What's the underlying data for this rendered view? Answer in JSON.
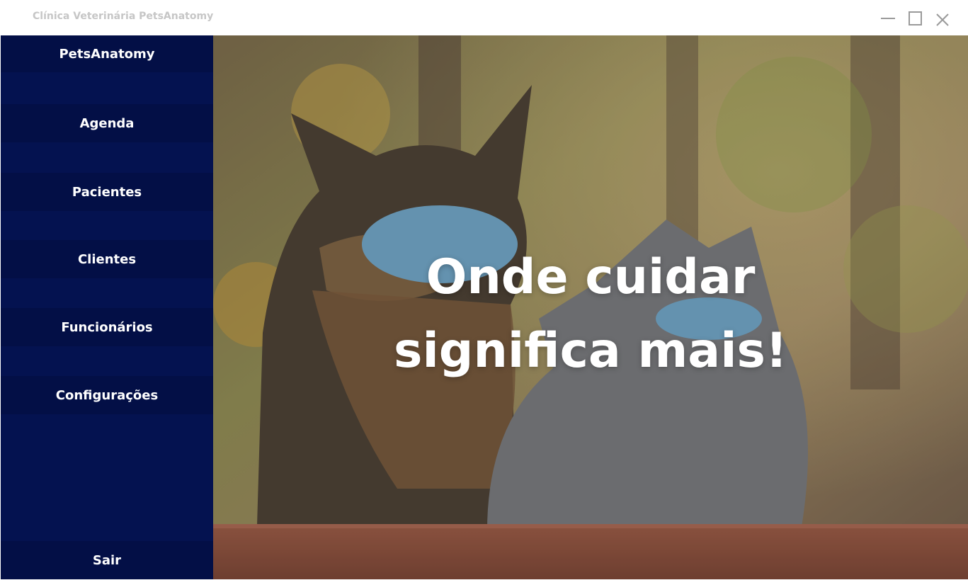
{
  "window": {
    "title": "Clínica Veterinária PetsAnatomy",
    "controls": [
      "minimize-icon",
      "maximize-icon",
      "close-icon"
    ]
  },
  "sidebar": {
    "brand": "PetsAnatomy",
    "items": [
      {
        "label": "Agenda"
      },
      {
        "label": "Pacientes"
      },
      {
        "label": "Clientes"
      },
      {
        "label": "Funcionários"
      },
      {
        "label": "Configurações"
      }
    ],
    "logout": "Sair"
  },
  "hero": {
    "headline_line1": "Onde cuidar",
    "headline_line2": "significa mais!"
  },
  "colors": {
    "sidebar_bg": "#041250",
    "nav_item_bg": "#030f46",
    "title_text": "#c6c6c6",
    "headline": "#ffffff"
  }
}
